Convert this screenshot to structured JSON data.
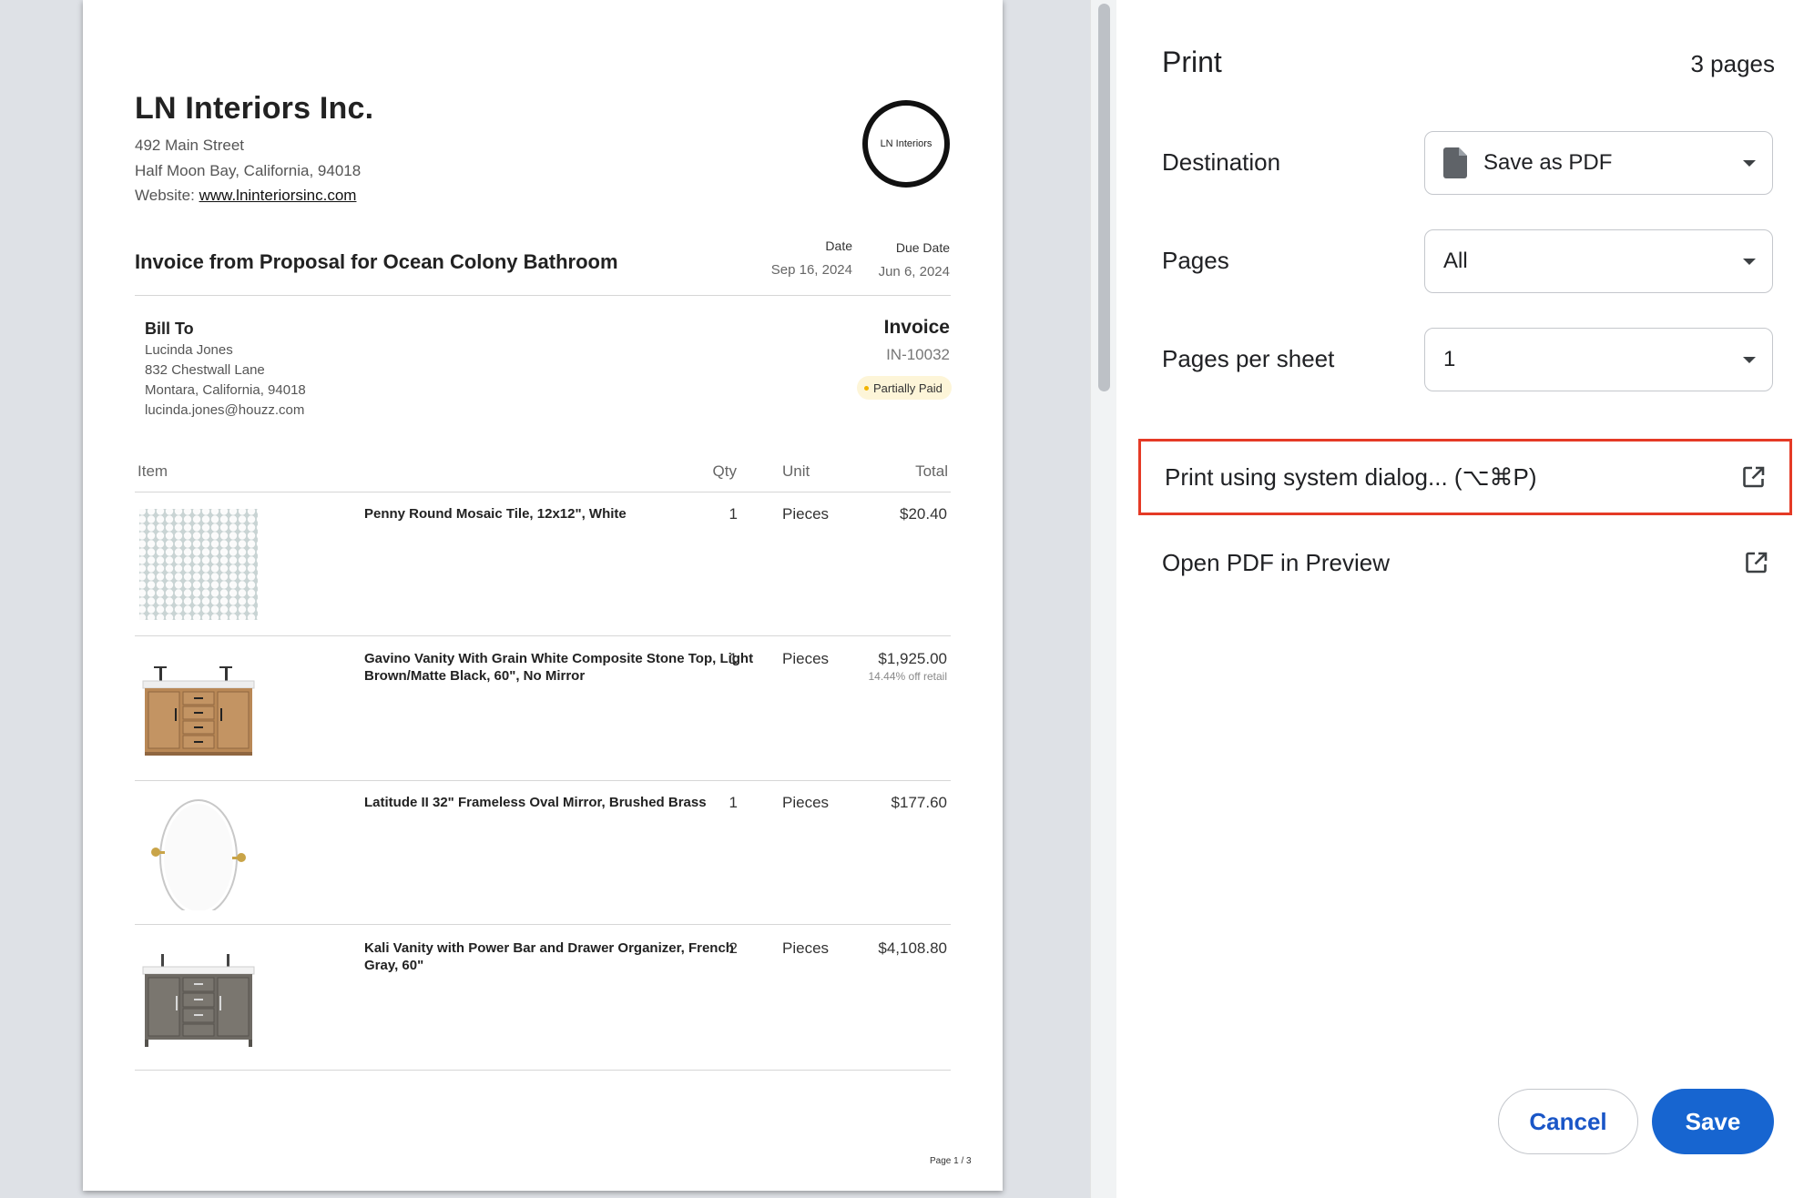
{
  "invoice": {
    "company_name": "LN Interiors Inc.",
    "address_line1": "492 Main Street",
    "address_line2": "Half Moon Bay, California, 94018",
    "website_label": "Website: ",
    "website_url": "www.lninteriorsinc.com",
    "logo_text": "LN Interiors",
    "title": "Invoice from Proposal for Ocean Colony Bathroom",
    "date_label": "Date",
    "date_value": "Sep 16, 2024",
    "due_date_label": "Due Date",
    "due_date_value": "Jun 6, 2024",
    "bill_to": {
      "heading": "Bill To",
      "name": "Lucinda Jones",
      "street": "832 Chestwall Lane",
      "city": "Montara, California, 94018",
      "email": "lucinda.jones@houzz.com"
    },
    "invoice_label": "Invoice",
    "invoice_number": "IN-10032",
    "status": "Partially Paid",
    "columns": {
      "item": "Item",
      "qty": "Qty",
      "unit": "Unit",
      "total": "Total"
    },
    "items": [
      {
        "name": "Penny Round Mosaic Tile, 12x12\", White",
        "qty": "1",
        "unit": "Pieces",
        "total": "$20.40",
        "discount": "",
        "thumb": "tile-thumbnail"
      },
      {
        "name": "Gavino Vanity With Grain White Composite Stone Top, Light Brown/Matte Black, 60\", No Mirror",
        "qty": "1",
        "unit": "Pieces",
        "total": "$1,925.00",
        "discount": "14.44% off retail",
        "thumb": "wood-vanity-thumbnail"
      },
      {
        "name": "Latitude II 32\" Frameless Oval Mirror, Brushed Brass",
        "qty": "1",
        "unit": "Pieces",
        "total": "$177.60",
        "discount": "",
        "thumb": "oval-mirror-thumbnail"
      },
      {
        "name": "Kali Vanity with Power Bar and Drawer Organizer, French Gray, 60\"",
        "qty": "2",
        "unit": "Pieces",
        "total": "$4,108.80",
        "discount": "",
        "thumb": "gray-vanity-thumbnail"
      }
    ],
    "page_number": "Page 1 / 3"
  },
  "print_dialog": {
    "title": "Print",
    "page_count": "3 pages",
    "destination_label": "Destination",
    "destination_value": "Save as PDF",
    "pages_label": "Pages",
    "pages_value": "All",
    "pages_per_sheet_label": "Pages per sheet",
    "pages_per_sheet_value": "1",
    "system_dialog_label": "Print using system dialog... (⌥⌘P)",
    "open_preview_label": "Open PDF in Preview",
    "cancel_label": "Cancel",
    "save_label": "Save"
  },
  "icons": {
    "destination": "document-icon",
    "dropdown": "caret-down-icon",
    "external": "open-external-icon"
  },
  "colors": {
    "accent": "#1765d0",
    "highlight_border": "#e53a26",
    "status_badge": "#fdf5d8"
  }
}
